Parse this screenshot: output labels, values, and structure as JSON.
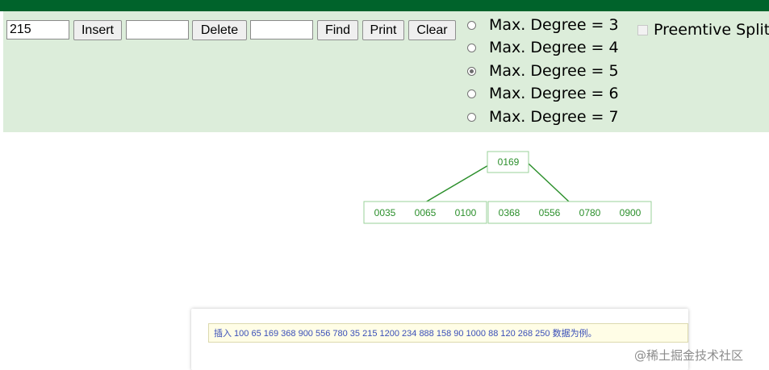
{
  "controls": {
    "insert_value": "215",
    "insert_label": "Insert",
    "delete_value": "",
    "delete_label": "Delete",
    "find_value": "",
    "find_label": "Find",
    "print_label": "Print",
    "clear_label": "Clear"
  },
  "degree_options": [
    {
      "label": "Max. Degree = 3",
      "checked": false
    },
    {
      "label": "Max. Degree = 4",
      "checked": false
    },
    {
      "label": "Max. Degree = 5",
      "checked": true
    },
    {
      "label": "Max. Degree = 6",
      "checked": false
    },
    {
      "label": "Max. Degree = 7",
      "checked": false
    }
  ],
  "preemptive_split": {
    "label": "Preemtive Split",
    "checked": false
  },
  "tree": {
    "root": [
      "0169"
    ],
    "children": [
      [
        "0035",
        "0065",
        "0100"
      ],
      [
        "0368",
        "0556",
        "0780",
        "0900"
      ]
    ]
  },
  "colors": {
    "topbar": "#00632b",
    "panel": "#dcedda",
    "node": "#2b8f2b"
  },
  "note": "插入 100 65 169 368 900 556 780 35 215 1200 234 888 158 90 1000 88 120 268 250 数据为例。",
  "watermark": "@稀土掘金技术社区"
}
